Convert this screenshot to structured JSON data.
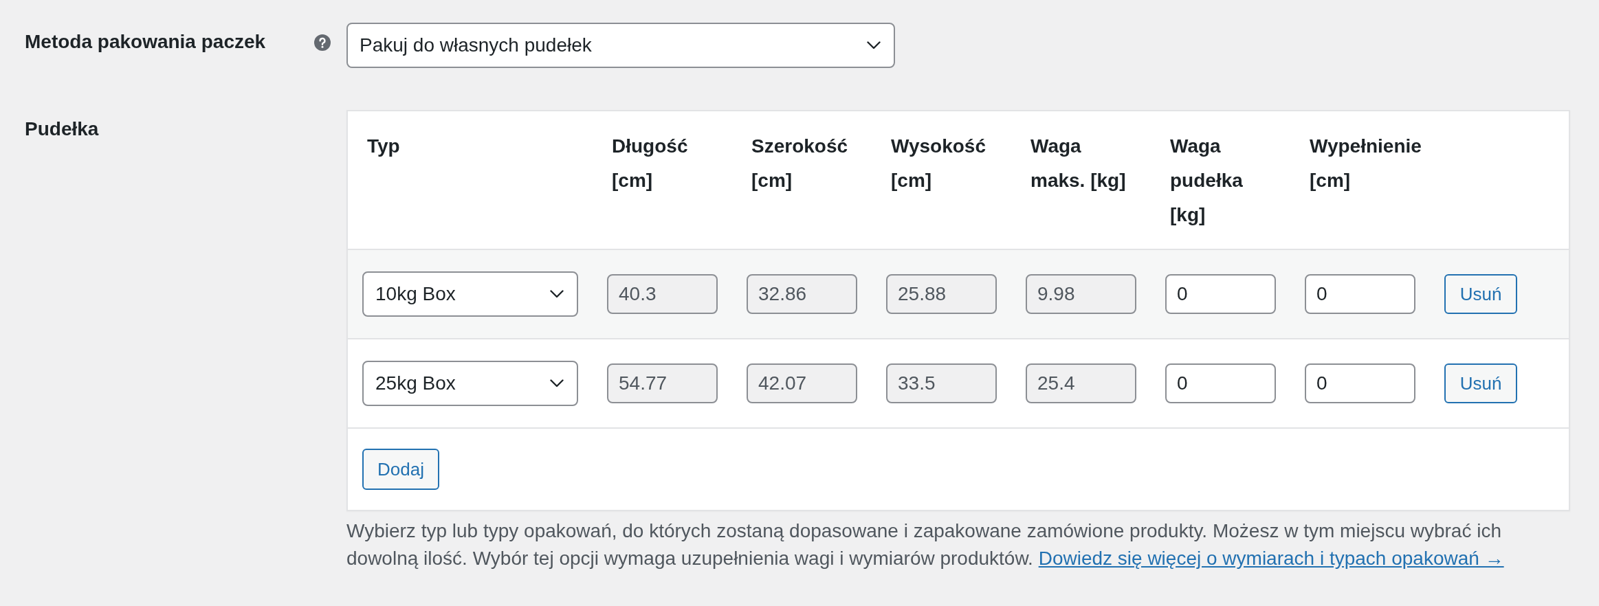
{
  "packing_method": {
    "label": "Metoda pakowania paczek",
    "help_tip": true,
    "value": "Pakuj do własnych pudełek"
  },
  "boxes": {
    "label": "Pudełka",
    "columns": [
      "Typ",
      "Długość [cm]",
      "Szerokość [cm]",
      "Wysokość [cm]",
      "Waga maks. [kg]",
      "Waga pudełka [kg]",
      "Wypełnienie [cm]"
    ],
    "rows": [
      {
        "cells": [
          {
            "kind": "select",
            "value": "10kg Box"
          },
          {
            "kind": "input",
            "value": "40.3",
            "readonly": true
          },
          {
            "kind": "input",
            "value": "32.86",
            "readonly": true
          },
          {
            "kind": "input",
            "value": "25.88",
            "readonly": true
          },
          {
            "kind": "input",
            "value": "9.98",
            "readonly": true
          },
          {
            "kind": "input",
            "value": "0",
            "readonly": false
          },
          {
            "kind": "input",
            "value": "0",
            "readonly": false
          }
        ],
        "remove_button": "Usuń"
      },
      {
        "cells": [
          {
            "kind": "select",
            "value": "25kg Box"
          },
          {
            "kind": "input",
            "value": "54.77",
            "readonly": true
          },
          {
            "kind": "input",
            "value": "42.07",
            "readonly": true
          },
          {
            "kind": "input",
            "value": "33.5",
            "readonly": true
          },
          {
            "kind": "input",
            "value": "25.4",
            "readonly": true
          },
          {
            "kind": "input",
            "value": "0",
            "readonly": false
          },
          {
            "kind": "input",
            "value": "0",
            "readonly": false
          }
        ],
        "remove_button": "Usuń"
      }
    ],
    "add_button": "Dodaj",
    "description": "Wybierz typ lub typy opakowań, do których zostaną dopasowane i zapakowane zamówione produkty. Możesz w tym miejscu wybrać ich dowolną ilość. Wybór tej opcji wymaga uzupełnienia wagi i wymiarów produktów.",
    "link": "Dowiedz się więcej o wymiarach i typach opakowań →"
  }
}
